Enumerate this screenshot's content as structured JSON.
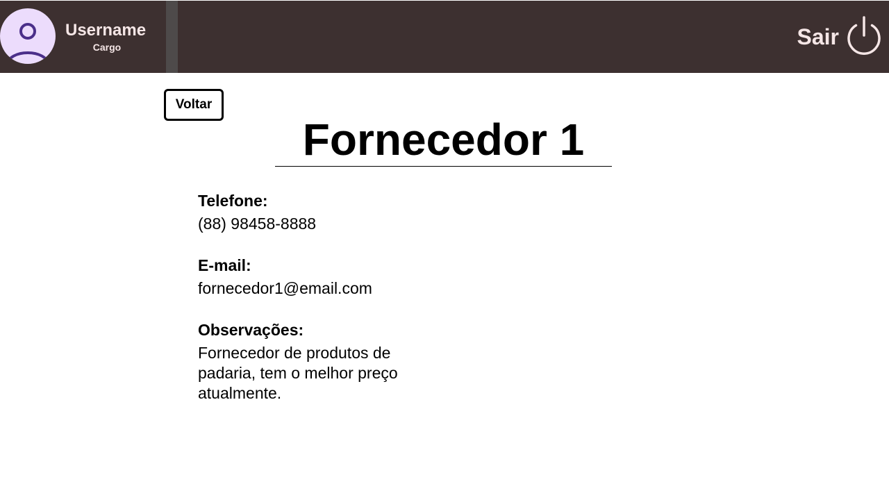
{
  "header": {
    "username": "Username",
    "role": "Cargo",
    "logout_label": "Sair",
    "background_color": "#3d3030",
    "text_color": "#f5e6e6",
    "avatar_icon": "user-avatar-icon",
    "logout_icon": "power-icon"
  },
  "page": {
    "back_label": "Voltar",
    "title": "Fornecedor 1"
  },
  "supplier": {
    "phone_label": "Telefone:",
    "phone": "(88) 98458-8888",
    "email_label": "E-mail:",
    "email": "fornecedor1@email.com",
    "notes_label": "Observações:",
    "notes": "Fornecedor de produtos de padaria, tem o melhor preço atualmente."
  }
}
